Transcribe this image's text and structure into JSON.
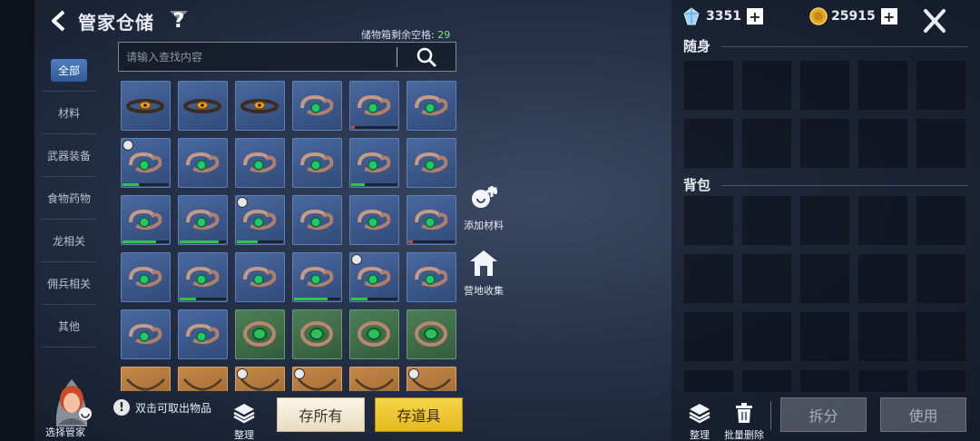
{
  "header": {
    "title": "管家仓储"
  },
  "capacity": {
    "label": "储物箱剩余空格:",
    "value": "29"
  },
  "categories": [
    {
      "label": "全部",
      "active": true
    },
    {
      "label": "材料"
    },
    {
      "label": "武器装备"
    },
    {
      "label": "食物药物"
    },
    {
      "label": "龙相关"
    },
    {
      "label": "佣兵相关"
    },
    {
      "label": "其他"
    }
  ],
  "search": {
    "placeholder": "请输入查找内容",
    "value": ""
  },
  "grid_items": [
    {
      "bg": "blue",
      "icon": "ring-amber-icon",
      "dur": null
    },
    {
      "bg": "blue",
      "icon": "ring-amber-icon",
      "dur": null
    },
    {
      "bg": "blue",
      "icon": "ring-amber-icon",
      "dur": null
    },
    {
      "bg": "blue",
      "icon": "ring-jade-icon",
      "dur": null
    },
    {
      "bg": "blue",
      "icon": "ring-jade-icon",
      "dur": {
        "pct": 0.08,
        "color": "#d04040"
      }
    },
    {
      "bg": "blue",
      "icon": "ring-jade-icon",
      "dur": null
    },
    {
      "bg": "blue",
      "icon": "ring-jade-icon",
      "dur": {
        "pct": 0.35,
        "color": "#33c24a"
      },
      "badge": true
    },
    {
      "bg": "blue",
      "icon": "ring-jade-icon",
      "dur": null
    },
    {
      "bg": "blue",
      "icon": "ring-jade-icon",
      "dur": null
    },
    {
      "bg": "blue",
      "icon": "ring-jade-icon",
      "dur": null
    },
    {
      "bg": "blue",
      "icon": "ring-jade-icon",
      "dur": {
        "pct": 0.3,
        "color": "#33c24a"
      }
    },
    {
      "bg": "blue",
      "icon": "ring-jade-icon",
      "dur": null
    },
    {
      "bg": "blue",
      "icon": "ring-jade-icon",
      "dur": {
        "pct": 0.72,
        "color": "#33c24a"
      }
    },
    {
      "bg": "blue",
      "icon": "ring-jade-icon",
      "dur": {
        "pct": 0.85,
        "color": "#33c24a"
      }
    },
    {
      "bg": "blue",
      "icon": "ring-jade-icon",
      "dur": {
        "pct": 0.45,
        "color": "#33c24a"
      },
      "badge": true
    },
    {
      "bg": "blue",
      "icon": "ring-jade-icon",
      "dur": null
    },
    {
      "bg": "blue",
      "icon": "ring-jade-icon",
      "dur": null
    },
    {
      "bg": "blue",
      "icon": "ring-jade-icon",
      "dur": {
        "pct": 0.1,
        "color": "#d04040"
      }
    },
    {
      "bg": "blue",
      "icon": "ring-jade-icon",
      "dur": null
    },
    {
      "bg": "blue",
      "icon": "ring-jade-icon",
      "dur": {
        "pct": 0.35,
        "color": "#33c24a"
      }
    },
    {
      "bg": "blue",
      "icon": "ring-jade-icon",
      "dur": null
    },
    {
      "bg": "blue",
      "icon": "ring-jade-icon",
      "dur": {
        "pct": 0.72,
        "color": "#33c24a"
      }
    },
    {
      "bg": "blue",
      "icon": "ring-jade-icon",
      "dur": {
        "pct": 0.35,
        "color": "#33c24a"
      },
      "badge": true
    },
    {
      "bg": "blue",
      "icon": "ring-jade-icon",
      "dur": null
    },
    {
      "bg": "blue",
      "icon": "ring-jade-icon",
      "dur": null
    },
    {
      "bg": "blue",
      "icon": "ring-jade-icon",
      "dur": null
    },
    {
      "bg": "green",
      "icon": "ring-emerald-icon",
      "dur": null
    },
    {
      "bg": "green",
      "icon": "ring-emerald-icon",
      "dur": null
    },
    {
      "bg": "green",
      "icon": "ring-emerald-icon",
      "dur": null
    },
    {
      "bg": "green",
      "icon": "ring-emerald-icon",
      "dur": null
    },
    {
      "bg": "orange",
      "icon": "amulet-icon",
      "dur": null
    },
    {
      "bg": "orange",
      "icon": "amulet-icon",
      "dur": null
    },
    {
      "bg": "orange",
      "icon": "amulet-icon",
      "dur": null,
      "badge": true
    },
    {
      "bg": "orange",
      "icon": "amulet-icon",
      "dur": null,
      "badge": true
    },
    {
      "bg": "orange",
      "icon": "amulet-icon",
      "dur": null
    },
    {
      "bg": "orange",
      "icon": "amulet-icon",
      "dur": null,
      "badge": true
    }
  ],
  "side_actions": {
    "add_material": "添加材料",
    "camp_collect": "营地收集"
  },
  "bottom_left": {
    "warning": "双击可取出物品",
    "butler_label": "选择管家",
    "sort_label": "整理",
    "store_all": "存所有",
    "store_items": "存道具"
  },
  "currency": {
    "crystal": "3351",
    "gold": "25915"
  },
  "right_panel": {
    "carry_title": "随身",
    "bag_title": "背包",
    "sort_label": "整理",
    "batch_delete_label": "批量删除",
    "split_label": "拆分",
    "use_label": "使用"
  },
  "colors": {
    "accent_yellow": "#f2cc3a",
    "capacity_green": "#8fe27a",
    "active_tab": "#3f6fb0"
  }
}
